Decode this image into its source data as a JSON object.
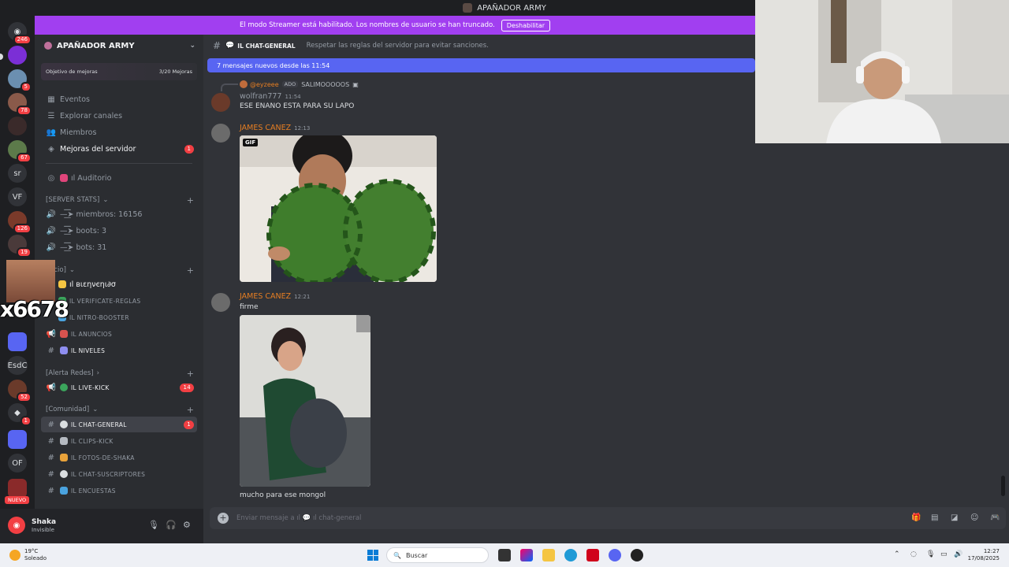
{
  "window": {
    "title": "APAÑADOR ARMY"
  },
  "banner": {
    "message": "El modo Streamer está habilitado. Los nombres de usuario se han truncado.",
    "button": "Deshabilitar"
  },
  "rail": {
    "badges": [
      "246",
      "5",
      "78",
      "67",
      "126",
      "19",
      "52",
      "1"
    ],
    "text_guilds": [
      "sr",
      "VF",
      "EsdC",
      "OF"
    ],
    "new_label": "NUEVO"
  },
  "overlay": {
    "text": "x6678"
  },
  "server": {
    "name": "APAÑADOR ARMY",
    "boost_goal": "Objetivo de mejoras",
    "boost_progress": "3/20 Mejoras",
    "nav": [
      {
        "label": "Eventos"
      },
      {
        "label": "Explorar canales"
      },
      {
        "label": "Miembros"
      },
      {
        "label": "Mejoras del servidor",
        "count": "1"
      }
    ],
    "auditorio": "ıl Auditorio",
    "categories": {
      "stats": "[SERVER STATS]",
      "inicio": "icio]",
      "alerta": "[Alerta Redes]",
      "comunidad": "[Comunidad]"
    },
    "stats_channels": [
      "—͟͞͞➤ miembros: 16156",
      "—͟͞͞➤ boots: 3",
      "—͟͞͞➤ bots: 31"
    ],
    "inicio_channels": [
      "ıl вιεηνєηι∂σ",
      "ıl verificate-reglas",
      "ıl nitro-booster",
      "ıl anuncios",
      "ıl niveles"
    ],
    "alerta_channels": [
      {
        "label": "ıl live-kick",
        "count": "14"
      }
    ],
    "comunidad_channels": [
      {
        "label": "ıl chat-general",
        "count": "1"
      },
      {
        "label": "ıl clips-kick"
      },
      {
        "label": "ıl fotos-de-shaka"
      },
      {
        "label": "ıl chat-suscriptores"
      },
      {
        "label": "ıl encuestas"
      }
    ]
  },
  "user": {
    "name": "Shaka",
    "status": "Invisible"
  },
  "chat": {
    "channel": "ıl chat-general",
    "topic": "Respetar las reglas del servidor para evitar sanciones.",
    "new_messages": "7 mensajes nuevos desde las 11:54",
    "reply": {
      "name": "@eyzeee",
      "tag": "ADO",
      "text": "SALIMOOOOOS"
    },
    "messages": [
      {
        "author": "wolfran777",
        "time": "11:54",
        "text": "ESE ENANO ESTA PARA SU LAPO"
      },
      {
        "author": "JAMES CANEZ",
        "time": "12:13",
        "gif_label": "GIF"
      },
      {
        "author": "JAMES CANEZ",
        "time": "12:21",
        "text": "firme",
        "caption": "mucho para ese mongol"
      }
    ],
    "composer_placeholder": "Enviar mensaje a ıl 💬 ıl chat-general"
  },
  "taskbar": {
    "temp": "19°C",
    "weather": "Soleado",
    "search": "Buscar",
    "time": "12:27",
    "date": "17/08/2025"
  },
  "colors": {
    "accent": "#5865f2",
    "banner": "#a13ff0",
    "username": "#e67e22",
    "badge": "#f23f43"
  }
}
